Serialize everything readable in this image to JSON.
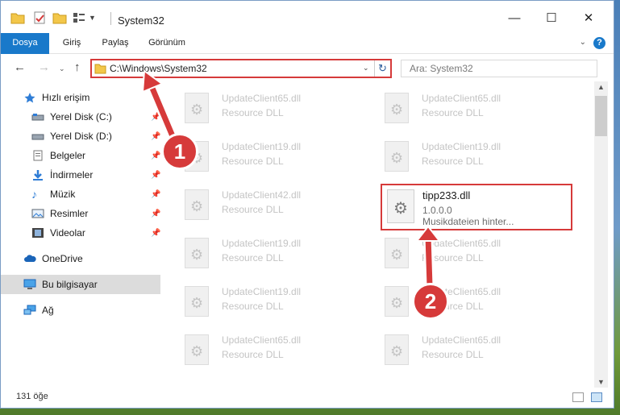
{
  "window": {
    "title": "System32",
    "controls": {
      "minimize": "—",
      "maximize": "☐",
      "close": "✕"
    }
  },
  "ribbon": {
    "tabs": [
      "Dosya",
      "Giriş",
      "Paylaş",
      "Görünüm"
    ],
    "help": "?",
    "expand": "⌄"
  },
  "address": {
    "path": "C:\\Windows\\System32",
    "search_placeholder": "Ara: System32"
  },
  "sidebar": {
    "items": [
      {
        "label": "Hızlı erişim",
        "icon": "star-icon",
        "pinned": false
      },
      {
        "label": "Yerel Disk (C:)",
        "icon": "drive-icon",
        "pinned": true
      },
      {
        "label": "Yerel Disk (D:)",
        "icon": "drive-icon",
        "pinned": true
      },
      {
        "label": "Belgeler",
        "icon": "documents-icon",
        "pinned": true
      },
      {
        "label": "İndirmeler",
        "icon": "download-icon",
        "pinned": true
      },
      {
        "label": "Müzik",
        "icon": "music-icon",
        "pinned": true
      },
      {
        "label": "Resimler",
        "icon": "pictures-icon",
        "pinned": true
      },
      {
        "label": "Videolar",
        "icon": "videos-icon",
        "pinned": true
      },
      {
        "label": "OneDrive",
        "icon": "cloud-icon",
        "pinned": false
      },
      {
        "label": "Bu bilgisayar",
        "icon": "computer-icon",
        "pinned": false
      },
      {
        "label": "Ağ",
        "icon": "network-icon",
        "pinned": false
      }
    ]
  },
  "files": {
    "left": [
      {
        "name": "UpdateClient65.dll",
        "type": "Resource DLL"
      },
      {
        "name": "UpdateClient19.dll",
        "type": "Resource DLL"
      },
      {
        "name": "UpdateClient42.dll",
        "type": "Resource DLL"
      },
      {
        "name": "UpdateClient19.dll",
        "type": "Resource DLL"
      },
      {
        "name": "UpdateClient19.dll",
        "type": "Resource DLL"
      },
      {
        "name": "UpdateClient65.dll",
        "type": "Resource DLL"
      }
    ],
    "right": [
      {
        "name": "UpdateClient65.dll",
        "type": "Resource DLL"
      },
      {
        "name": "UpdateClient19.dll",
        "type": "Resource DLL"
      },
      {
        "name": "UpdateClient65.dll",
        "type": "Resource DLL"
      },
      {
        "name": "UpdateClient65.dll",
        "type": "Resource DLL"
      },
      {
        "name": "UpdateClient65.dll",
        "type": "Resource DLL"
      }
    ],
    "highlighted": {
      "name": "tipp233.dll",
      "version": "1.0.0.0",
      "description": "Musikdateien hinter..."
    }
  },
  "status": {
    "count": "131 öğe"
  },
  "callouts": {
    "one": "1",
    "two": "2"
  },
  "colors": {
    "accent": "#1979ca",
    "highlight": "#d63a3a"
  }
}
